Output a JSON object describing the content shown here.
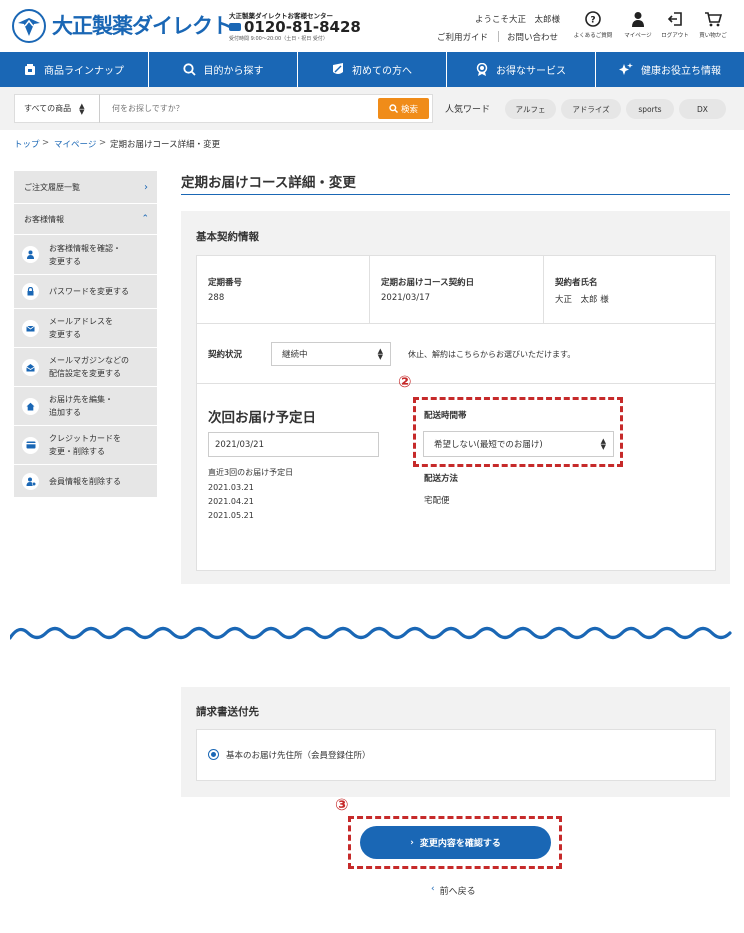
{
  "header": {
    "logo_text": "大正製薬ダイレクト",
    "call_center_label": "大正製薬ダイレクトお客様センター",
    "phone": "0120-81-8428",
    "hours": "受付時間 9:00〜20:00（土日・祝日 受付）",
    "welcome": "ようこそ大正　太郎様",
    "guide_link": "ご利用ガイド",
    "contact_link": "お問い合わせ",
    "icons": [
      {
        "label": "よくあるご質問",
        "icon": "question-icon"
      },
      {
        "label": "マイページ",
        "icon": "person-icon"
      },
      {
        "label": "ログアウト",
        "icon": "logout-icon"
      },
      {
        "label": "買い物かご",
        "icon": "cart-icon"
      }
    ]
  },
  "nav": {
    "items": [
      {
        "label": "商品ラインナップ",
        "icon": "product-icon"
      },
      {
        "label": "目的から探す",
        "icon": "search-icon"
      },
      {
        "label": "初めての方へ",
        "icon": "leaf-icon"
      },
      {
        "label": "お得なサービス",
        "icon": "medal-icon"
      },
      {
        "label": "健康お役立ち情報",
        "icon": "sparkle-icon"
      }
    ]
  },
  "search": {
    "category": "すべての商品",
    "placeholder": "何をお探しですか？",
    "button": "検索",
    "keywords_label": "人気ワード",
    "keywords": [
      "アルフェ",
      "アドライズ",
      "sports",
      "DX"
    ]
  },
  "breadcrumb": {
    "items": [
      "トップ",
      "マイページ",
      "定期お届けコース詳細・変更"
    ],
    "separator": ">"
  },
  "sidebar": {
    "order_history": "ご注文履歴一覧",
    "customer_info": "お客様情報",
    "items": [
      {
        "line1": "お客様情報を確認・",
        "line2": "変更する",
        "icon": "user-icon"
      },
      {
        "line1": "パスワードを変更する",
        "line2": "",
        "icon": "lock-icon"
      },
      {
        "line1": "メールアドレスを",
        "line2": "変更する",
        "icon": "mail-icon"
      },
      {
        "line1": "メールマガジンなどの",
        "line2": "配信設定を変更する",
        "icon": "mail-open-icon"
      },
      {
        "line1": "お届け先を編集・",
        "line2": "追加する",
        "icon": "home-icon"
      },
      {
        "line1": "クレジットカードを",
        "line2": "変更・削除する",
        "icon": "card-icon"
      },
      {
        "line1": "会員情報を削除する",
        "line2": "",
        "icon": "user-remove-icon"
      }
    ]
  },
  "main": {
    "page_title": "定期お届けコース詳細・変更",
    "contract": {
      "heading": "基本契約情報",
      "number_label": "定期番号",
      "number_value": "288",
      "contract_date_label": "定期お届けコース契約日",
      "contract_date_value": "2021/03/17",
      "name_label": "契約者氏名",
      "name_value": "大正　太郎 様",
      "status_label": "契約状況",
      "status_value": "継続中",
      "status_note": "休止、解約はこちらからお選びいただけます。",
      "next_delivery_heading": "次回お届け予定日",
      "next_delivery_value": "2021/03/21",
      "recent_label": "直近3回のお届け予定日",
      "recent_dates": [
        "2021.03.21",
        "2021.04.21",
        "2021.05.21"
      ],
      "time_label": "配送時間帯",
      "time_value": "希望しない(最短でのお届け)",
      "method_label": "配送方法",
      "method_value": "宅配便"
    },
    "billing": {
      "heading": "請求書送付先",
      "option": "基本のお届け先住所（会員登録住所）"
    },
    "confirm_button": "変更内容を確認する",
    "back_link": "前へ戻る",
    "annotation_2": "②",
    "annotation_3": "③"
  },
  "colors": {
    "brand_blue": "#1a67b5",
    "search_orange": "#f08c19",
    "annotation_red": "#c62a2a"
  }
}
